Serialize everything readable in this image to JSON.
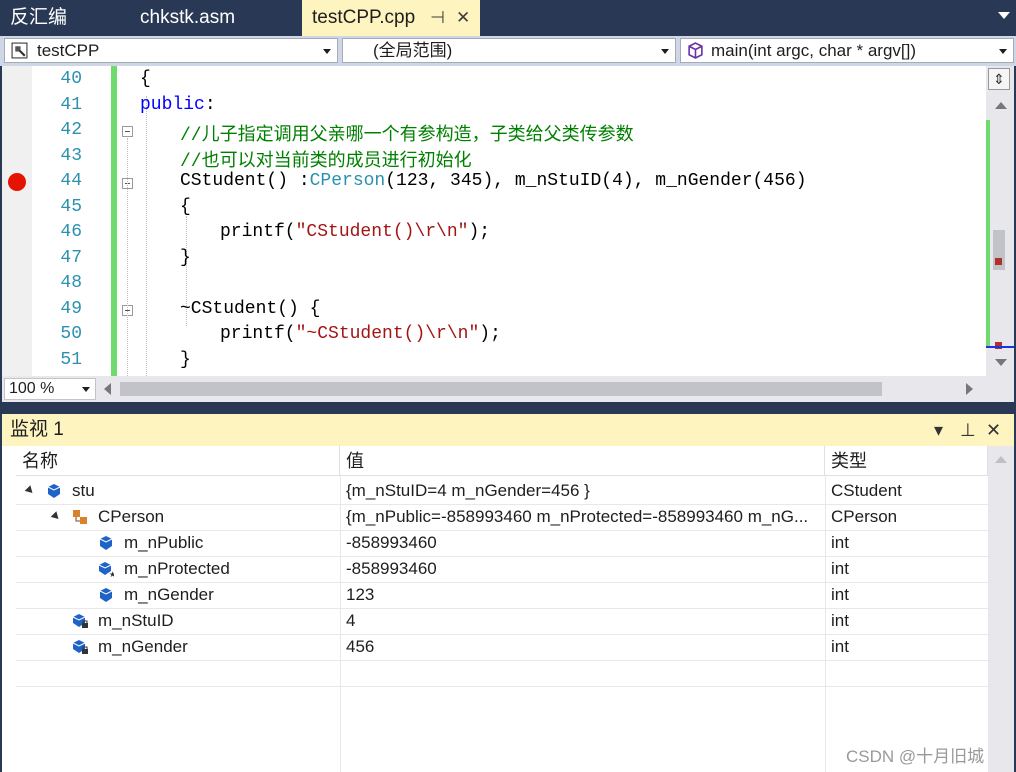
{
  "tabs": [
    {
      "label": "反汇编"
    },
    {
      "label": "chkstk.asm"
    },
    {
      "label": "testCPP.cpp",
      "pin": "⊣",
      "close": "✕"
    }
  ],
  "navbar": {
    "project": "testCPP",
    "scope": "(全局范围)",
    "function": "main(int argc, char * argv[])"
  },
  "editor": {
    "line_numbers": [
      "40",
      "41",
      "42",
      "43",
      "44",
      "45",
      "46",
      "47",
      "48",
      "49",
      "50",
      "51"
    ],
    "breakpoint_line": "44",
    "lines": {
      "l40": "{",
      "l41_kw": "public",
      "l41_rest": ":",
      "l42": "//儿子指定调用父亲哪一个有参构造，子类给父类传参数",
      "l43": "//也可以对当前类的成员进行初始化",
      "l44_a": "CStudent() :",
      "l44_type": "CPerson",
      "l44_b": "(123, 345), m_nStuID(4), m_nGender(456)",
      "l45": "{",
      "l46_a": "printf(",
      "l46_str": "\"CStudent()\\r\\n\"",
      "l46_b": ");",
      "l47": "}",
      "l48": "",
      "l49": "~CStudent() {",
      "l50_a": "printf(",
      "l50_str": "\"~CStudent()\\r\\n\"",
      "l50_b": ");",
      "l51": "}"
    },
    "zoom": "100 %"
  },
  "watch": {
    "title": "监视 1",
    "columns": {
      "name": "名称",
      "value": "值",
      "type": "类型"
    },
    "rows": [
      {
        "name": "stu",
        "value": "{m_nStuID=4 m_nGender=456 }",
        "type": "CStudent"
      },
      {
        "name": "CPerson",
        "value": "{m_nPublic=-858993460 m_nProtected=-858993460 m_nG...",
        "type": "CPerson"
      },
      {
        "name": "m_nPublic",
        "value": "-858993460",
        "type": "int"
      },
      {
        "name": "m_nProtected",
        "value": "-858993460",
        "type": "int"
      },
      {
        "name": "m_nGender",
        "value": "123",
        "type": "int"
      },
      {
        "name": "m_nStuID",
        "value": "4",
        "type": "int"
      },
      {
        "name": "m_nGender",
        "value": "456",
        "type": "int"
      }
    ],
    "header_buttons": {
      "dropdown": "▾",
      "pin": "⊥",
      "close": "✕"
    }
  },
  "watermark": "CSDN @十月旧城",
  "colors": {
    "accent_tab": "#fdf4bf",
    "chrome": "#293955",
    "breakpoint": "#e51400",
    "changed": "#6fdb6f"
  }
}
